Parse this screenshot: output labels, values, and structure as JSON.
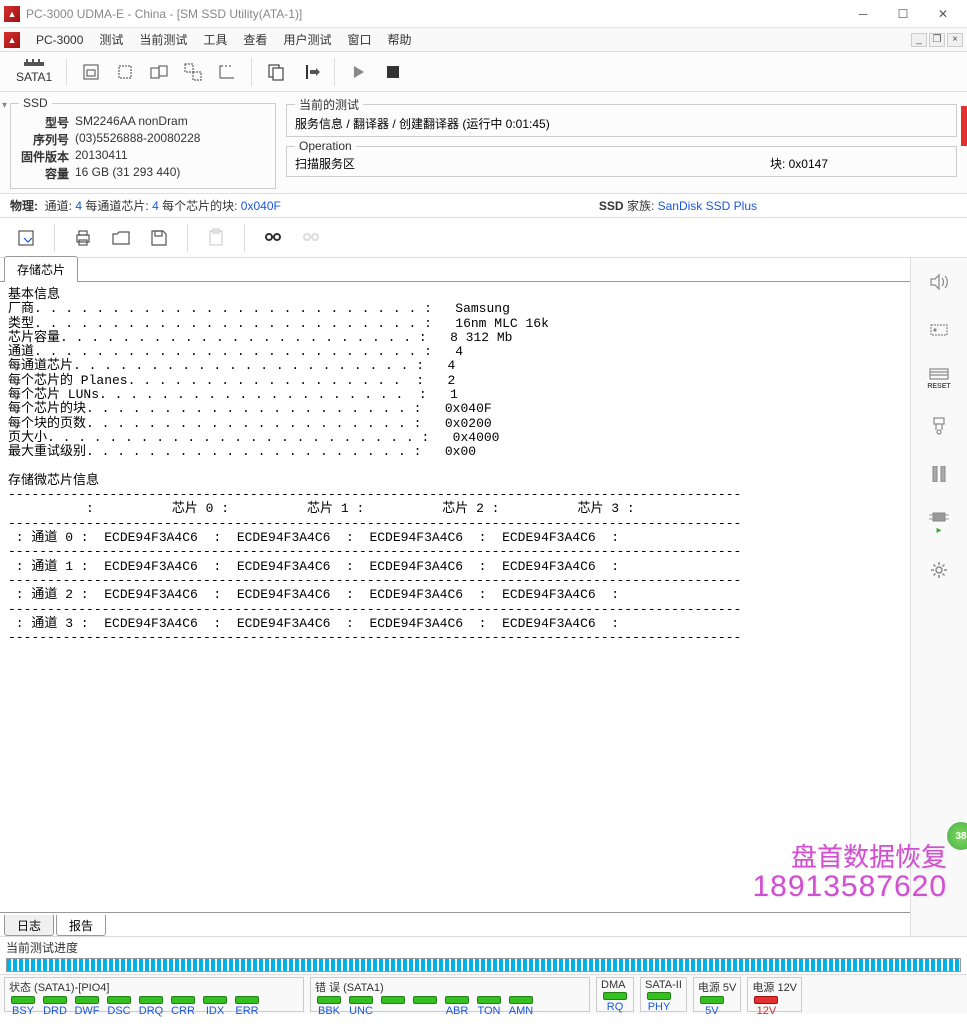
{
  "title": "PC-3000 UDMA-E - China - [SM SSD Utility(ATA-1)]",
  "menubar": {
    "brand": "PC-3000",
    "items": [
      "测试",
      "当前测试",
      "工具",
      "查看",
      "用户测试",
      "窗口",
      "帮助"
    ]
  },
  "sata_port": "SATA1",
  "info": {
    "group": "SSD",
    "model_l": "型号",
    "model_v": "SM2246AA nonDram",
    "serial_l": "序列号",
    "serial_v": "(03)5526888-20080228",
    "fw_l": "固件版本",
    "fw_v": "20130411",
    "cap_l": "容量",
    "cap_v": "16 GB (31 293 440)"
  },
  "current_test": {
    "legend": "当前的测试",
    "text": "服务信息 / 翻译器 / 创建翻译器 (运行中 0:01:45)"
  },
  "operation": {
    "legend": "Operation",
    "text": "扫描服务区",
    "block_l": "块:",
    "block_v": "0x0147"
  },
  "phys": {
    "l1": "物理:",
    "l2": "通道:",
    "v2": "4",
    "l3": "每通道芯片:",
    "v3": "4",
    "l4": "每个芯片的块:",
    "v4": "0x040F",
    "r1": "SSD",
    "r2": "家族:",
    "r3": "SanDisk SSD Plus"
  },
  "tab_storage": "存储芯片",
  "report_lines": [
    "基本信息",
    "厂商. . . . . . . . . . . . . . . . . . . . . . . . . :   Samsung",
    "类型. . . . . . . . . . . . . . . . . . . . . . . . . :   16nm MLC 16k",
    "芯片容量. . . . . . . . . . . . . . . . . . . . . . . :   8 312 Mb",
    "通道. . . . . . . . . . . . . . . . . . . . . . . . . :   4",
    "每通道芯片. . . . . . . . . . . . . . . . . . . . . . :   4",
    "每个芯片的 Planes. . . . . . . . . . . . . . . . . .  :   2",
    "每个芯片 LUNs. . . . . . . . . . . . . . . . . . . .  :   1",
    "每个芯片的块. . . . . . . . . . . . . . . . . . . . . :   0x040F",
    "每个块的页数. . . . . . . . . . . . . . . . . . . . . :   0x0200",
    "页大小. . . . . . . . . . . . . . . . . . . . . . . . :   0x4000",
    "最大重试级别. . . . . . . . . . . . . . . . . . . . . :   0x00",
    "",
    "存储微芯片信息",
    "----------------------------------------------------------------------------------------------",
    "          :          芯片 0 :          芯片 1 :          芯片 2 :          芯片 3 :",
    "----------------------------------------------------------------------------------------------",
    " : 通道 0 :  ECDE94F3A4C6  :  ECDE94F3A4C6  :  ECDE94F3A4C6  :  ECDE94F3A4C6  :",
    "----------------------------------------------------------------------------------------------",
    " : 通道 1 :  ECDE94F3A4C6  :  ECDE94F3A4C6  :  ECDE94F3A4C6  :  ECDE94F3A4C6  :",
    "----------------------------------------------------------------------------------------------",
    " : 通道 2 :  ECDE94F3A4C6  :  ECDE94F3A4C6  :  ECDE94F3A4C6  :  ECDE94F3A4C6  :",
    "----------------------------------------------------------------------------------------------",
    " : 通道 3 :  ECDE94F3A4C6  :  ECDE94F3A4C6  :  ECDE94F3A4C6  :  ECDE94F3A4C6  :",
    "----------------------------------------------------------------------------------------------"
  ],
  "bottom_tabs": {
    "log": "日志",
    "report": "报告"
  },
  "progress_label": "当前测试进度",
  "status": {
    "g1": "状态 (SATA1)-[PIO4]",
    "g1_leds": [
      "BSY",
      "DRD",
      "DWF",
      "DSC",
      "DRQ",
      "CRR",
      "IDX",
      "ERR"
    ],
    "g2": "错 误 (SATA1)",
    "g2_leds": [
      "BBK",
      "UNC",
      "",
      "",
      "ABR",
      "TON",
      "AMN"
    ],
    "g3": "DMA",
    "g3_leds": [
      "RQ"
    ],
    "g4": "SATA-II",
    "g4_leds": [
      "PHY"
    ],
    "g5": "电源 5V",
    "g5_leds": [
      "5V"
    ],
    "g6": "电源 12V",
    "g6_leds": [
      "12V"
    ]
  },
  "rightbar": {
    "reset": "RESET"
  },
  "watermark": {
    "text": "盘首数据恢复",
    "phone": "18913587620"
  },
  "badge": "38"
}
